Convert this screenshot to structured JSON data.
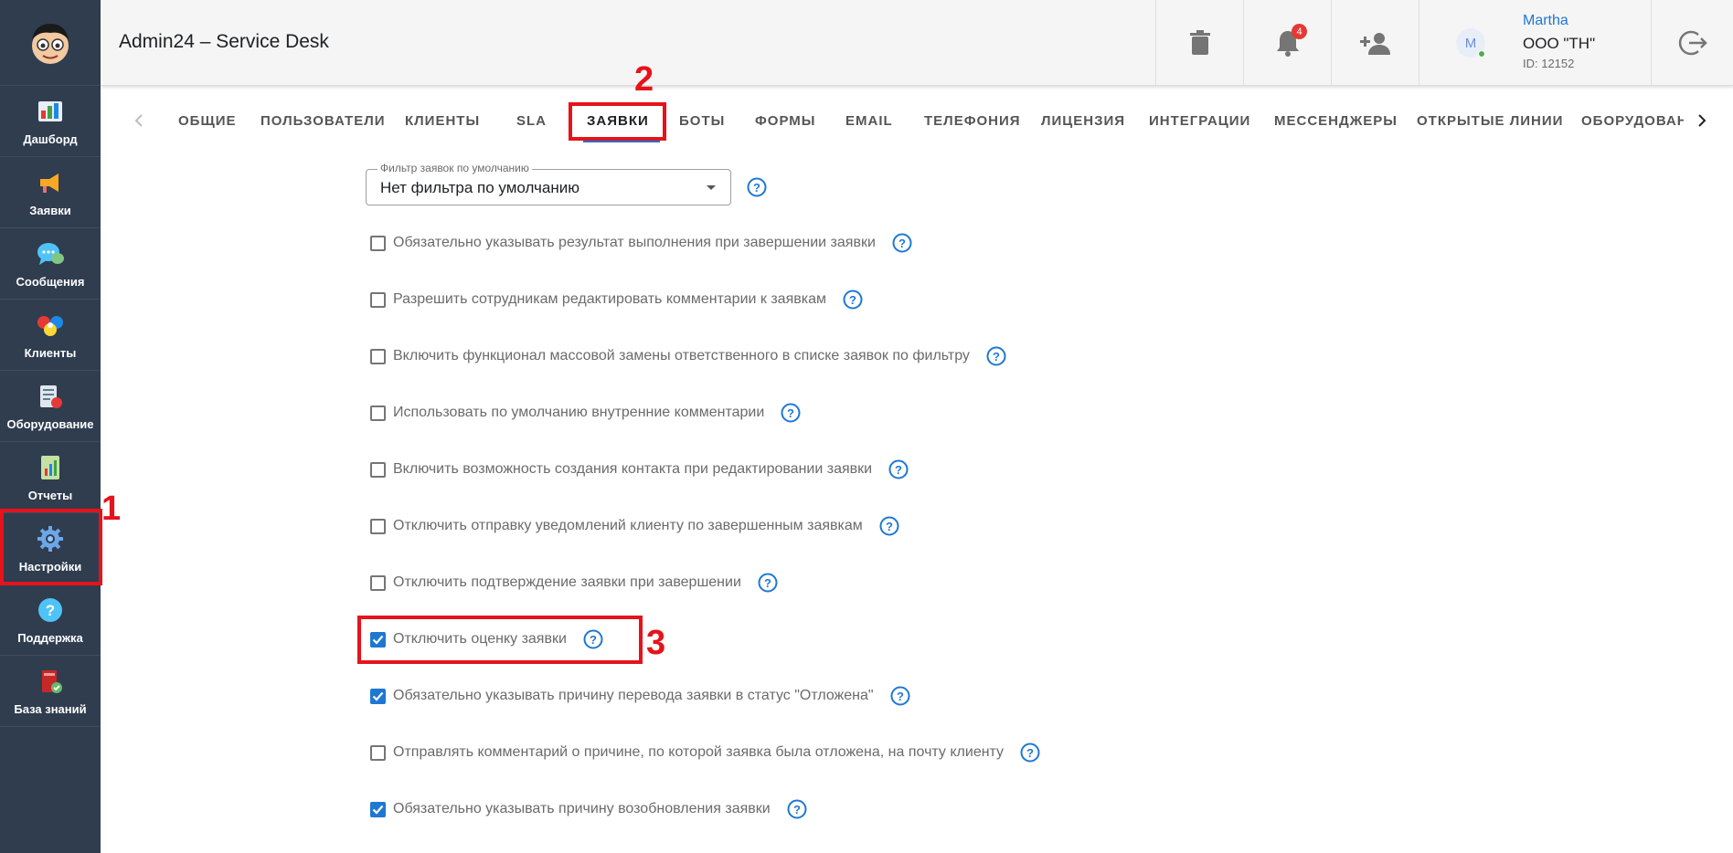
{
  "app": {
    "title": "Admin24 – Service Desk"
  },
  "sidebar": {
    "items": [
      {
        "label": "Дашборд",
        "icon": "dashboard-icon"
      },
      {
        "label": "Заявки",
        "icon": "megaphone-icon"
      },
      {
        "label": "Сообщения",
        "icon": "chat-bubble-icon"
      },
      {
        "label": "Клиенты",
        "icon": "clients-icon"
      },
      {
        "label": "Оборудование",
        "icon": "equipment-icon"
      },
      {
        "label": "Отчеты",
        "icon": "reports-icon"
      },
      {
        "label": "Настройки",
        "icon": "gear-icon"
      },
      {
        "label": "Поддержка",
        "icon": "help-icon"
      },
      {
        "label": "База знаний",
        "icon": "book-icon"
      }
    ]
  },
  "header": {
    "notifications_count": "4",
    "user": {
      "avatar_letter": "M",
      "name": "Martha",
      "org": "ООО \"ТН\"",
      "id": "ID: 12152"
    }
  },
  "tabs": {
    "items": [
      "ОБЩИЕ",
      "ПОЛЬЗОВАТЕЛИ",
      "КЛИЕНТЫ",
      "SLA",
      "ЗАЯВКИ",
      "БОТЫ",
      "ФОРМЫ",
      "EMAIL",
      "ТЕЛЕФОНИЯ",
      "ЛИЦЕНЗИЯ",
      "ИНТЕГРАЦИИ",
      "МЕССЕНДЖЕРЫ",
      "ОТКРЫТЫЕ ЛИНИИ",
      "ОБОРУДОВАН"
    ],
    "active": "ЗАЯВКИ"
  },
  "annotations": {
    "n1": "1",
    "n2": "2",
    "n3": "3"
  },
  "filter": {
    "legend": "Фильтр заявок по умолчанию",
    "value": "Нет фильтра по умолчанию"
  },
  "options": [
    {
      "label": "Обязательно указывать результат выполнения при завершении заявки",
      "checked": false
    },
    {
      "label": "Разрешить сотрудникам редактировать комментарии к заявкам",
      "checked": false
    },
    {
      "label": "Включить функционал массовой замены ответственного в списке заявок по фильтру",
      "checked": false
    },
    {
      "label": "Использовать по умолчанию внутренние комментарии",
      "checked": false
    },
    {
      "label": "Включить возможность создания контакта при редактировании заявки",
      "checked": false
    },
    {
      "label": "Отключить отправку уведомлений клиенту по завершенным заявкам",
      "checked": false
    },
    {
      "label": "Отключить подтверждение заявки при завершении",
      "checked": false
    },
    {
      "label": "Отключить оценку заявки",
      "checked": true
    },
    {
      "label": "Обязательно указывать причину перевода заявки в статус \"Отложена\"",
      "checked": true
    },
    {
      "label": "Отправлять комментарий о причине, по которой заявка была отложена, на почту клиенту",
      "checked": false
    },
    {
      "label": "Обязательно указывать причину возобновления заявки",
      "checked": true
    }
  ],
  "colors": {
    "sidebar": "#2f3d4f",
    "accent": "#1e78d2",
    "highlight": "#e5131b"
  }
}
